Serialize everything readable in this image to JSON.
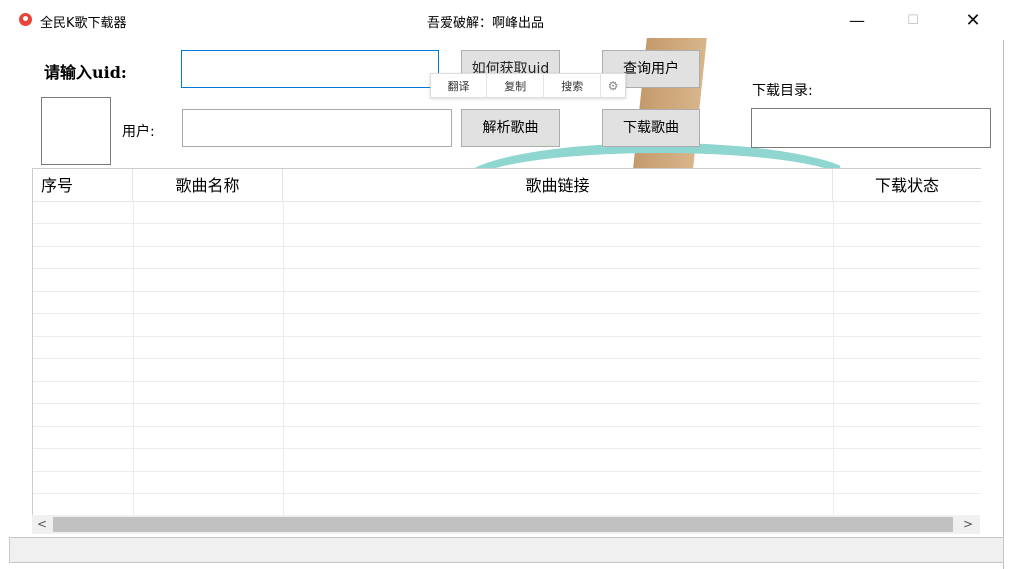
{
  "window": {
    "title": "全民K歌下载器",
    "subtitle": "吾爱破解：啊峰出品",
    "min_glyph": "—",
    "max_glyph": "☐",
    "close_glyph": "✕"
  },
  "form": {
    "uid_label": "请输入uid:",
    "uid_value": "",
    "user_label": "用户:",
    "user_value": "",
    "dir_label": "下载目录:",
    "dir_value": ""
  },
  "buttons": {
    "how_to_get": "如何获取uid",
    "query_user": "查询用户",
    "parse_songs": "解析歌曲",
    "download_songs": "下载歌曲"
  },
  "popup": {
    "translate": "翻译",
    "copy": "复制",
    "search": "搜索",
    "settings_icon": "gear-icon"
  },
  "table": {
    "columns": [
      "序号",
      "歌曲名称",
      "歌曲链接",
      "下载状态"
    ],
    "rows": []
  },
  "scrollbar": {
    "left_arrow": "<",
    "right_arrow": ">"
  }
}
